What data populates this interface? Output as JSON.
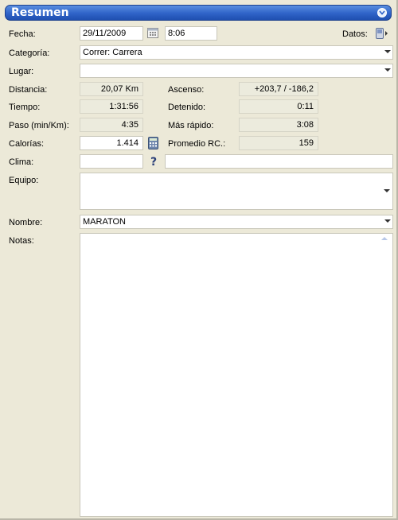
{
  "panel": {
    "title": "Resumen"
  },
  "labels": {
    "fecha": "Fecha:",
    "datos": "Datos:",
    "categoria": "Categoría:",
    "lugar": "Lugar:",
    "distancia": "Distancia:",
    "ascenso": "Ascenso:",
    "tiempo": "Tiempo:",
    "detenido": "Detenido:",
    "paso": "Paso (min/Km):",
    "mas_rapido": "Más rápido:",
    "calorias": "Calorías:",
    "promedio_rc": "Promedio RC.:",
    "clima": "Clima:",
    "equipo": "Equipo:",
    "nombre": "Nombre:",
    "notas": "Notas:"
  },
  "values": {
    "fecha": "29/11/2009",
    "hora": "8:06",
    "categoria": "Correr: Carrera",
    "lugar": "",
    "distancia": "20,07 Km",
    "ascenso": "+203,7 / -186,2",
    "tiempo": "1:31:56",
    "detenido": "0:11",
    "paso": "4:35",
    "mas_rapido": "3:08",
    "calorias": "1.414",
    "promedio_rc": "159",
    "clima_temp": "",
    "clima_desc": "",
    "equipo": "",
    "nombre": "MARATON",
    "notas": ""
  },
  "icons": {
    "collapse": "chevron-down-circle-icon",
    "calendar": "calendar-icon",
    "datos": "device-data-icon",
    "calculator": "calculator-icon",
    "weather": "question-icon"
  }
}
